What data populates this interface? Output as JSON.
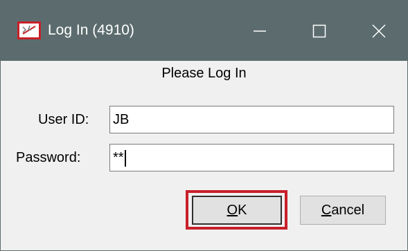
{
  "window": {
    "title": "Log In (4910)",
    "icons": {
      "app": "app-icon",
      "minimize": "minimize-icon",
      "maximize": "maximize-icon",
      "close": "close-icon"
    }
  },
  "form": {
    "heading": "Please Log In",
    "user_id_label": "User ID:",
    "user_id_value": "JB",
    "password_label": "Password:",
    "password_value": "**"
  },
  "buttons": {
    "ok_label": "OK",
    "cancel_label": "Cancel"
  },
  "colors": {
    "titlebar": "#5c6c6e",
    "highlight": "#c8202a",
    "app_icon": "#c8202a"
  }
}
